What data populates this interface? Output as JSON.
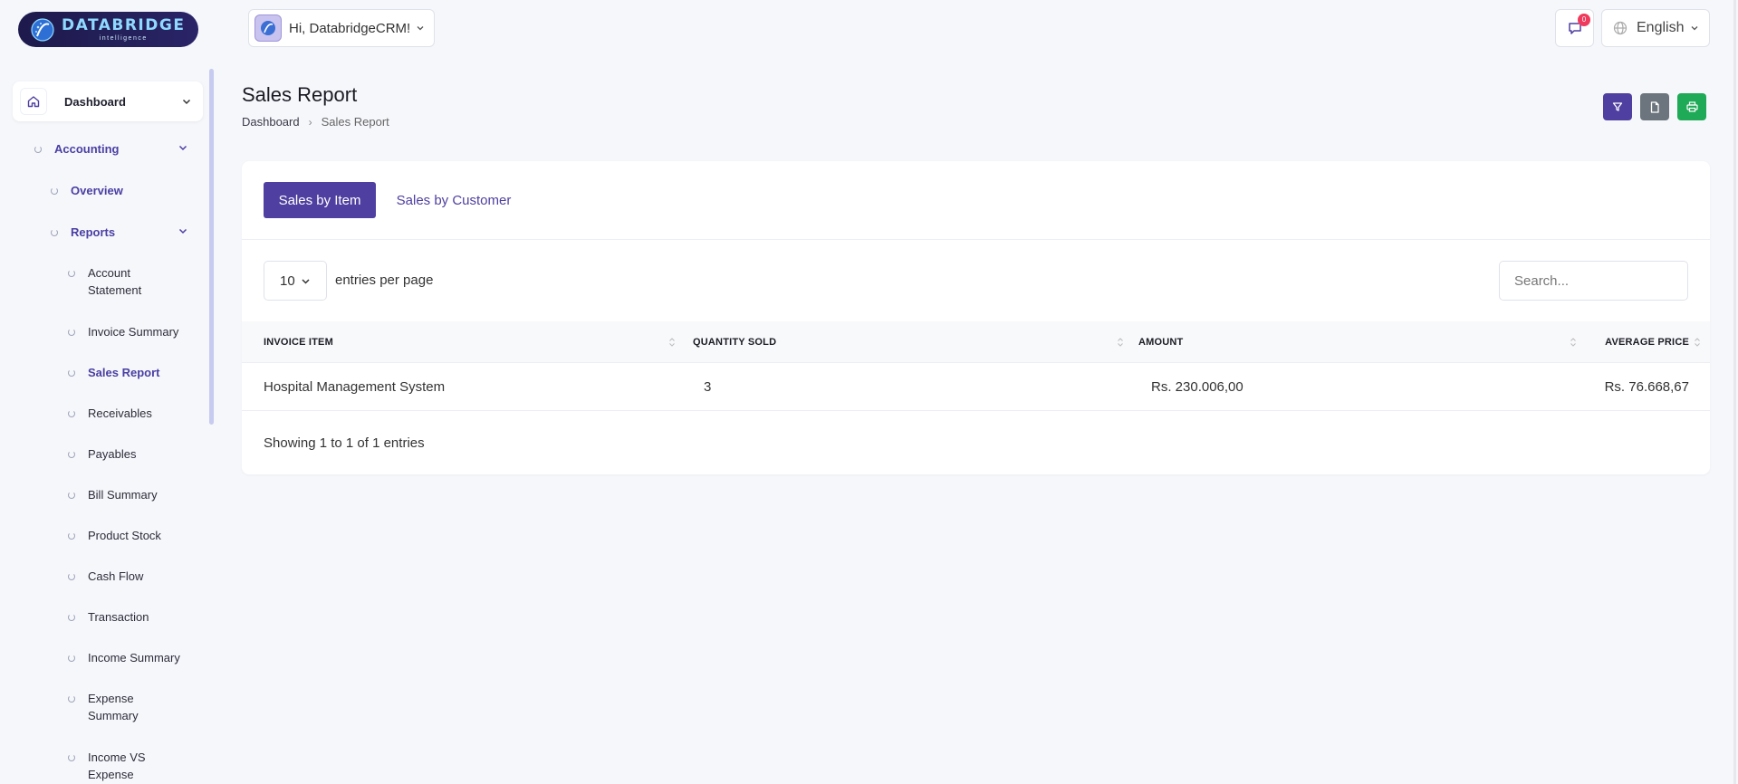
{
  "app": {
    "logo_main": "DATABRIDGE",
    "logo_sub": "intelligence",
    "greeting": "Hi, DatabridgeCRM!",
    "notification_count": "0",
    "language": "English"
  },
  "sidebar": {
    "dashboard": "Dashboard",
    "accounting": "Accounting",
    "overview": "Overview",
    "reports": "Reports",
    "report_items": [
      "Account Statement",
      "Invoice Summary",
      "Sales Report",
      "Receivables",
      "Payables",
      "Bill Summary",
      "Product Stock",
      "Cash Flow",
      "Transaction",
      "Income Summary",
      "Expense Summary",
      "Income VS Expense"
    ],
    "active_item": "Sales Report"
  },
  "page": {
    "title": "Sales Report",
    "breadcrumb": [
      "Dashboard",
      "Sales Report"
    ]
  },
  "tabs": [
    "Sales by Item",
    "Sales by Customer"
  ],
  "table": {
    "entries_value": "10",
    "entries_label": "entries per page",
    "search_placeholder": "Search...",
    "columns": [
      "INVOICE ITEM",
      "QUANTITY SOLD",
      "AMOUNT",
      "AVERAGE PRICE"
    ],
    "rows": [
      [
        "Hospital Management System",
        "3",
        "Rs. 230.006,00",
        "Rs. 76.668,67"
      ]
    ],
    "info": "Showing 1 to 1 of 1 entries"
  },
  "colors": {
    "brand": "#4f3fa0",
    "print_button": "#1faa57",
    "export_button": "#6c757d",
    "badge": "#ef3a5d"
  },
  "icons": {
    "home": "home-icon",
    "filter": "filter-icon",
    "export": "file-icon",
    "print": "printer-icon",
    "notifications": "chat-bell-icon",
    "language": "globe-icon"
  }
}
